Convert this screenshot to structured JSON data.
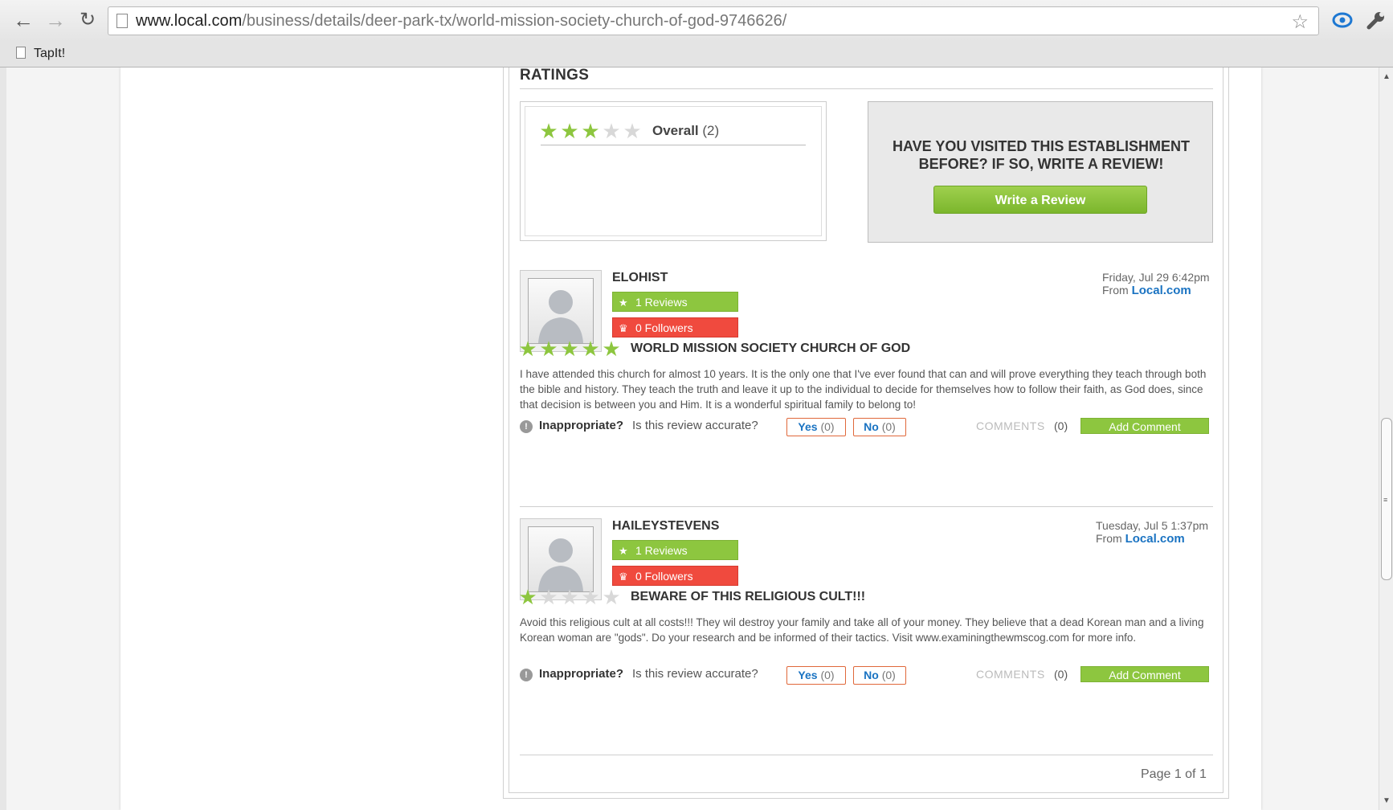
{
  "browser": {
    "url_host": "www.local.com",
    "url_path": "/business/details/deer-park-tx/world-mission-society-church-of-god-9746626/",
    "bookmark": "TapIt!"
  },
  "ratings": {
    "heading": "RATINGS",
    "overall_rating": 3,
    "overall_label": "Overall",
    "overall_count": "(2)",
    "cta_text_line1": "HAVE YOU VISITED THIS ESTABLISHMENT",
    "cta_text_line2": "BEFORE? IF SO, WRITE A REVIEW!",
    "write_review_label": "Write a Review"
  },
  "reviews": [
    {
      "user": "ELOHIST",
      "reviews_badge": "1 Reviews",
      "followers_badge": "0 Followers",
      "date": "Friday, Jul 29 6:42pm",
      "from_label": "From",
      "source": "Local.com",
      "rating": 5,
      "title": "WORLD MISSION SOCIETY CHURCH OF GOD",
      "body": "I have attended this church for almost 10 years. It is the only one that I've ever found that can and will prove everything they teach through both the bible and history. They teach the truth and leave it up to the individual to decide for themselves how to follow their faith, as God does, since that decision is between you and Him. It is a wonderful spiritual family to belong to!",
      "inappropriate_label": "Inappropriate?",
      "accurate_q": "Is this review accurate?",
      "yes_label": "Yes",
      "yes_count": "(0)",
      "no_label": "No",
      "no_count": "(0)",
      "comments_label": "COMMENTS",
      "comments_count": "(0)",
      "add_comment_label": "Add Comment"
    },
    {
      "user": "HAILEYSTEVENS",
      "reviews_badge": "1 Reviews",
      "followers_badge": "0 Followers",
      "date": "Tuesday, Jul 5 1:37pm",
      "from_label": "From",
      "source": "Local.com",
      "rating": 1,
      "title": "BEWARE OF THIS RELIGIOUS CULT!!!",
      "body": "Avoid this religious cult at all costs!!! They wil destroy your family and take all of your money. They believe that a dead Korean man and a living Korean woman are \"gods\". Do your research and be informed of their tactics. Visit www.examiningthewmscog.com for more info.",
      "inappropriate_label": "Inappropriate?",
      "accurate_q": "Is this review accurate?",
      "yes_label": "Yes",
      "yes_count": "(0)",
      "no_label": "No",
      "no_count": "(0)",
      "comments_label": "COMMENTS",
      "comments_count": "(0)",
      "add_comment_label": "Add Comment"
    }
  ],
  "pagination": "Page 1 of 1",
  "colors": {
    "accent_green": "#8dc63f",
    "followers_red": "#f04a3e",
    "link_blue": "#1a73c2"
  },
  "icons": [
    "back-arrow-icon",
    "forward-arrow-icon",
    "reload-icon",
    "page-icon",
    "bookmark-star-icon",
    "extension-icon",
    "wrench-icon",
    "star-icon",
    "trophy-icon",
    "info-icon"
  ]
}
